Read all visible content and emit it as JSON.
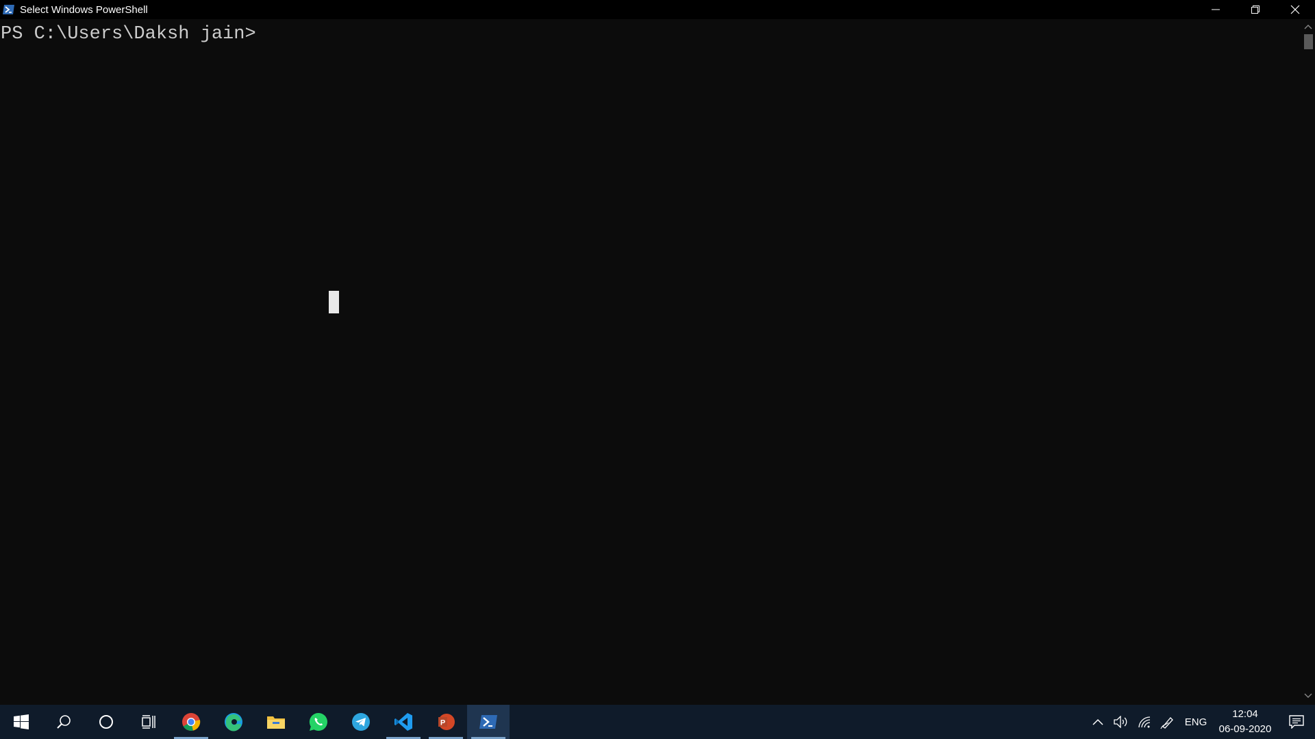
{
  "window": {
    "title": "Select Windows PowerShell",
    "icon": "powershell-icon",
    "controls": [
      "minimize-icon",
      "restore-icon",
      "close-icon"
    ]
  },
  "console": {
    "prompt": "PS C:\\Users\\Daksh jain>"
  },
  "taskbar": {
    "buttons": [
      {
        "name": "start-button",
        "icon": "windows-logo-icon"
      },
      {
        "name": "search-button",
        "icon": "search-icon"
      },
      {
        "name": "cortana-button",
        "icon": "cortana-circle-icon"
      },
      {
        "name": "task-view-button",
        "icon": "task-view-icon"
      },
      {
        "name": "chrome-button",
        "icon": "chrome-icon",
        "running": true
      },
      {
        "name": "edge-button",
        "icon": "edge-icon"
      },
      {
        "name": "file-explorer-button",
        "icon": "folder-icon"
      },
      {
        "name": "whatsapp-button",
        "icon": "whatsapp-icon"
      },
      {
        "name": "telegram-button",
        "icon": "telegram-icon"
      },
      {
        "name": "vscode-button",
        "icon": "vscode-icon",
        "running": true
      },
      {
        "name": "powerpoint-button",
        "icon": "powerpoint-icon",
        "running": true
      },
      {
        "name": "powershell-button",
        "icon": "powershell-icon",
        "running": true,
        "active": true
      }
    ],
    "tray": {
      "icons": [
        "chevron-up-icon",
        "volume-icon",
        "wifi-icon",
        "pen-icon"
      ],
      "language": "ENG",
      "time": "12:04",
      "date": "06-09-2020",
      "notification_icon": "action-center-icon"
    }
  },
  "colors": {
    "console_bg": "#0c0c0c",
    "console_text": "#cccccc",
    "titlebar_bg": "#000000",
    "taskbar_bg": "#0f1b2a",
    "accent": "#7aa2c9"
  }
}
